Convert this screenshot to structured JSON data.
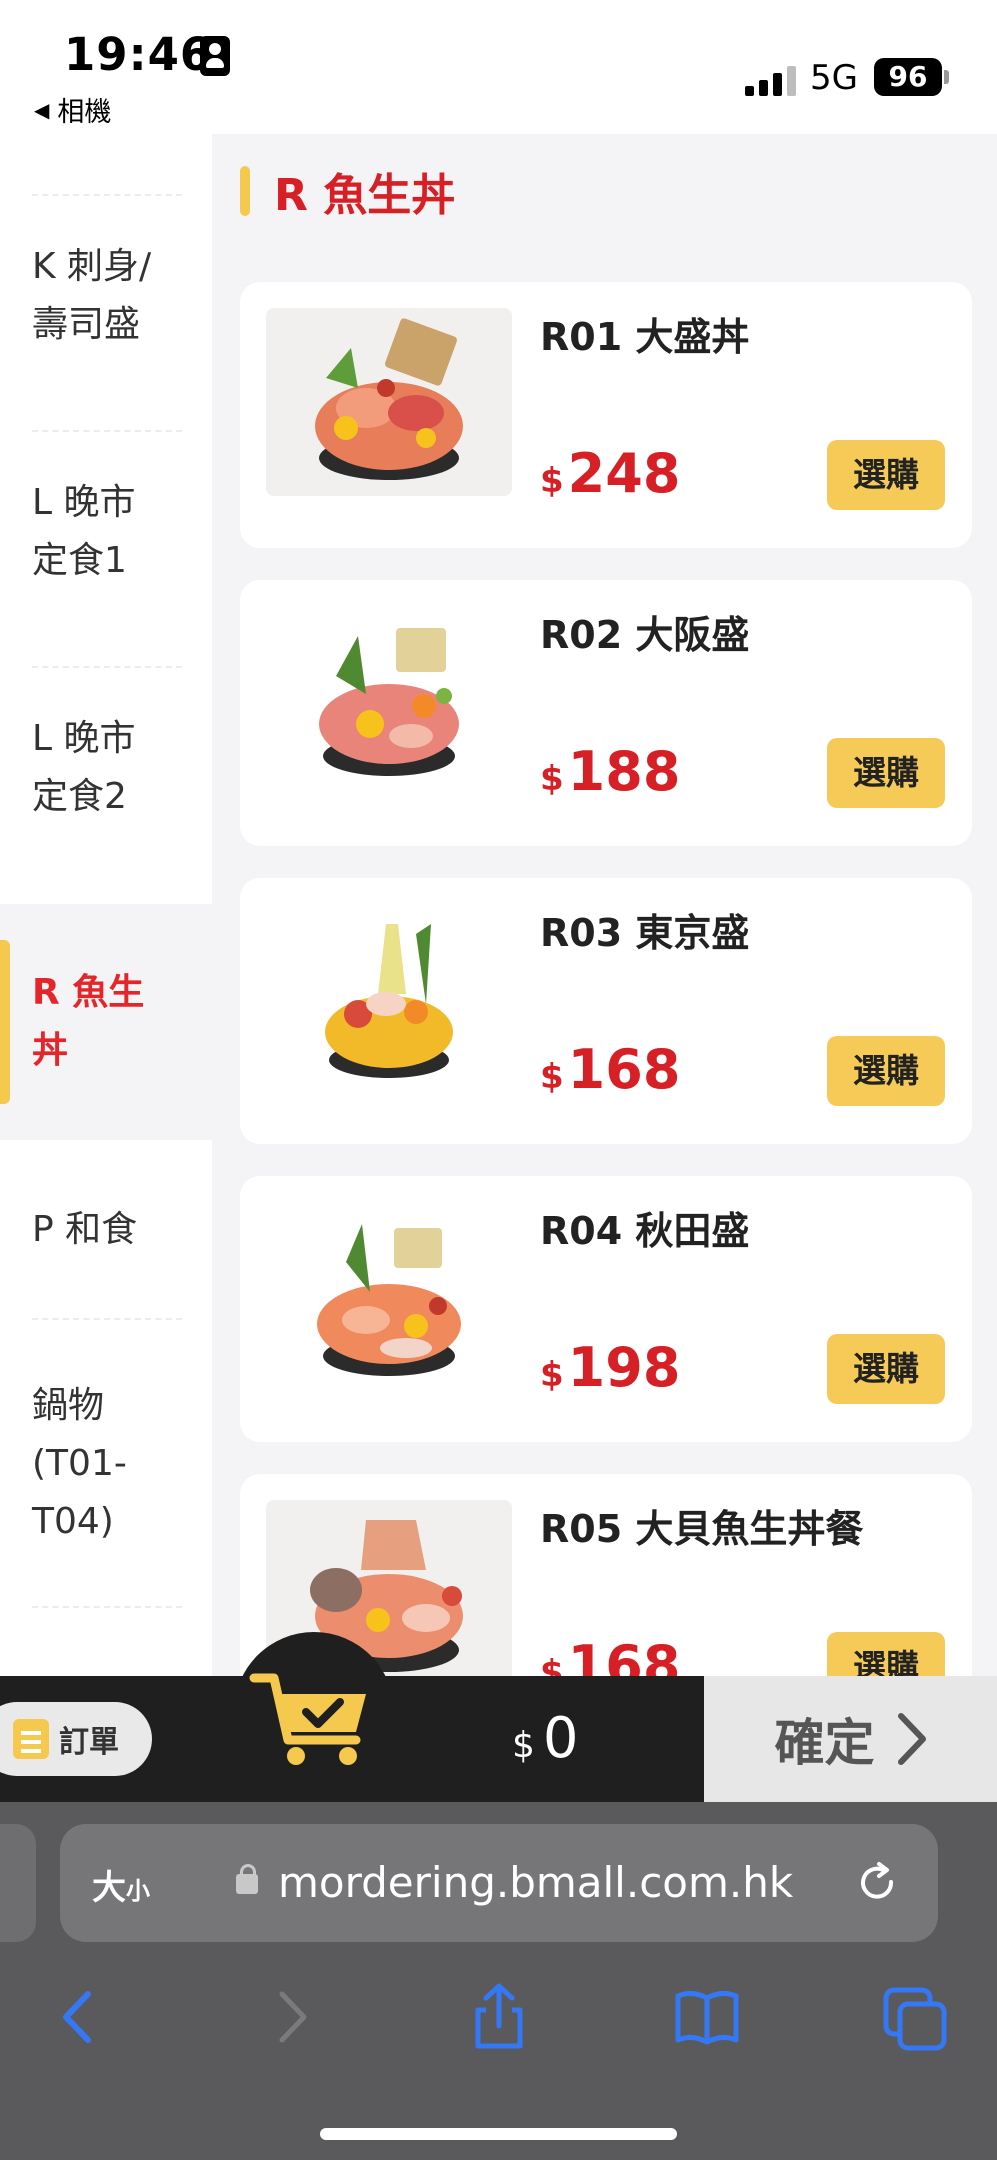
{
  "status_bar": {
    "time": "19:46",
    "back_app": "相機",
    "network": "5G",
    "battery": "96"
  },
  "sidebar": {
    "items": [
      {
        "label": "K 刺身/\n壽司盛",
        "active": false
      },
      {
        "label": "L 晚市\n定食1",
        "active": false
      },
      {
        "label": "L 晚市\n定食2",
        "active": false
      },
      {
        "label": "R 魚生\n丼",
        "active": true
      },
      {
        "label": "P 和食",
        "active": false
      },
      {
        "label": "鍋物\n(T01-\nT04)",
        "active": false
      }
    ]
  },
  "section": {
    "title": "R 魚生丼"
  },
  "products": [
    {
      "name": "R01 大盛丼",
      "currency": "$",
      "price": "248",
      "buy_label": "選購"
    },
    {
      "name": "R02 大阪盛",
      "currency": "$",
      "price": "188",
      "buy_label": "選購"
    },
    {
      "name": "R03 東京盛",
      "currency": "$",
      "price": "168",
      "buy_label": "選購"
    },
    {
      "name": "R04 秋田盛",
      "currency": "$",
      "price": "198",
      "buy_label": "選購"
    },
    {
      "name": "R05 大貝魚生丼餐",
      "currency": "$",
      "price": "168",
      "buy_label": "選購"
    }
  ],
  "cart": {
    "order_label": "訂單",
    "currency": "$",
    "amount": "0",
    "confirm_label": "確定"
  },
  "browser": {
    "text_size_label_big": "大",
    "text_size_label_small": "小",
    "url": "mordering.bmall.com.hk"
  },
  "colors": {
    "accent_red": "#d62026",
    "accent_yellow": "#f5c94d",
    "cart_dark": "#1f1f1f",
    "browser_gray": "#5a5a5c",
    "ios_blue": "#3478f6"
  },
  "icons": [
    "person-icon",
    "back-triangle-icon",
    "signal-icon",
    "battery-icon",
    "order-list-icon",
    "cart-icon",
    "chevron-right-icon",
    "lock-icon",
    "reload-icon",
    "back-arrow-icon",
    "forward-arrow-icon",
    "share-icon",
    "bookmarks-icon",
    "tabs-icon"
  ]
}
